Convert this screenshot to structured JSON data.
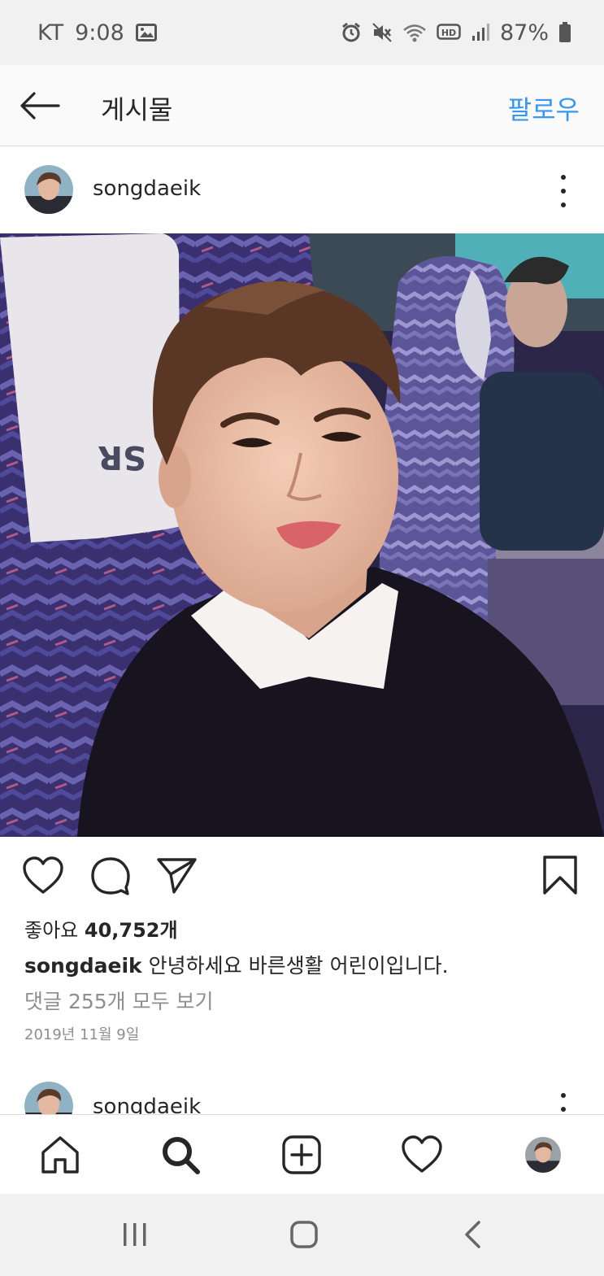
{
  "status_bar": {
    "carrier": "KT",
    "time": "9:08",
    "battery_percent": "87%",
    "icons": [
      "image-icon",
      "alarm-icon",
      "mute-icon",
      "wifi-icon",
      "hd-voice-icon",
      "signal-icon",
      "battery-icon"
    ]
  },
  "header": {
    "title": "게시물",
    "follow_label": "팔로우",
    "accent_color": "#3897f0"
  },
  "post": {
    "username": "songdaeik",
    "photo_seat_text": "SR",
    "likes_label": "좋아요",
    "likes_count": "40,752개",
    "caption_username": "songdaeik",
    "caption_text": "안녕하세요 바른생활 어린이입니다.",
    "view_comments": "댓글 255개 모두 보기",
    "date": "2019년 11월 9일"
  },
  "next_post": {
    "username": "songdaeik"
  },
  "bottom_nav": {
    "items": [
      "home-icon",
      "search-icon",
      "add-post-icon",
      "activity-heart-icon",
      "profile-avatar"
    ]
  },
  "system_nav": {
    "items": [
      "recent-apps-icon",
      "home-button-icon",
      "back-icon"
    ]
  }
}
